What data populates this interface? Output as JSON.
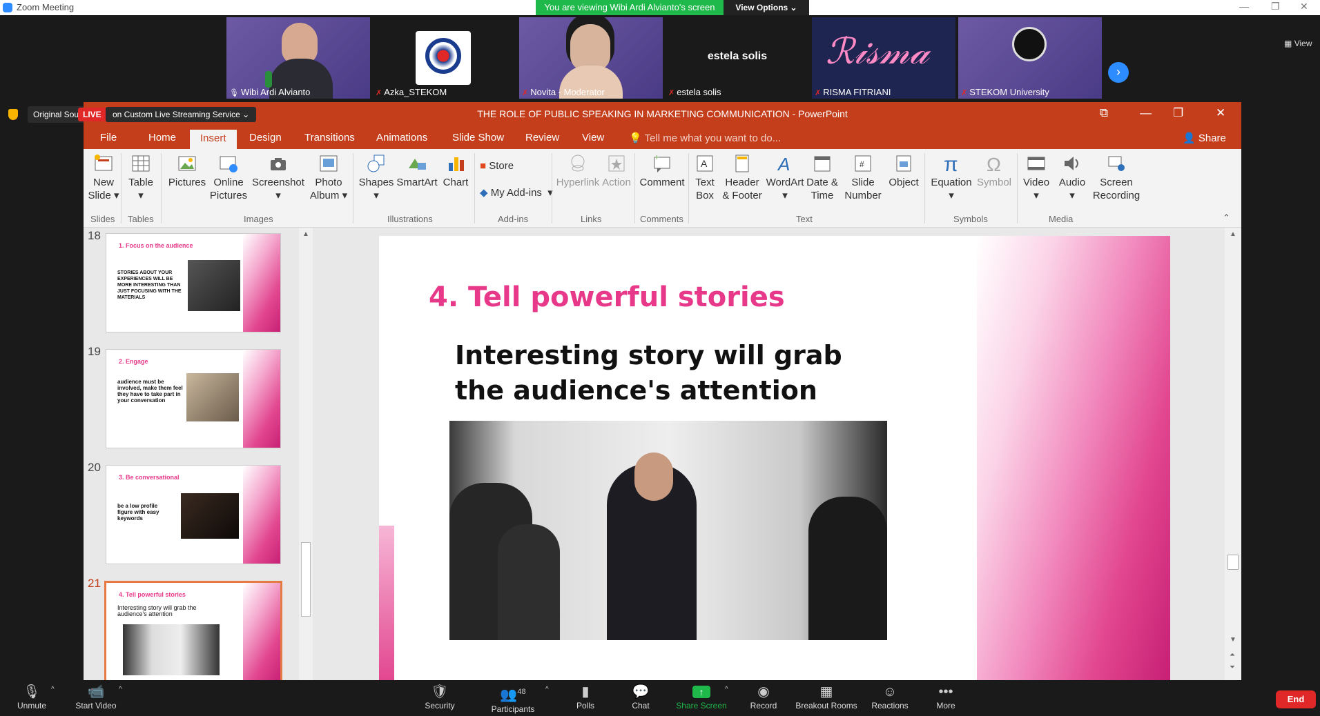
{
  "zoom": {
    "window_title": "Zoom Meeting",
    "viewing_banner": "You are viewing Wibi Ardi Alvianto's screen",
    "view_options": "View Options",
    "view_label": "View",
    "participants": [
      {
        "name": "Wibi Ardi Alvianto",
        "muted": false
      },
      {
        "name": "Azka_STEKOM",
        "muted": true
      },
      {
        "name": "Novita - Moderator",
        "muted": true
      },
      {
        "name": "estela solis",
        "muted": true
      },
      {
        "name": "RISMA FITRIANI",
        "muted": true
      },
      {
        "name": "STEKOM University",
        "muted": true
      }
    ],
    "estela_center_name": "estela solis",
    "original_sound": "Original Sound: On",
    "live_badge": "LIVE",
    "live_text": "on Custom Live Streaming Service",
    "toolbar": {
      "unmute": "Unmute",
      "start_video": "Start Video",
      "security": "Security",
      "participants": "Participants",
      "participants_count": "48",
      "polls": "Polls",
      "chat": "Chat",
      "share_screen": "Share Screen",
      "record": "Record",
      "breakout_rooms": "Breakout Rooms",
      "reactions": "Reactions",
      "more": "More",
      "end": "End"
    }
  },
  "ppt": {
    "title": "THE ROLE OF PUBLIC SPEAKING IN MARKETING COMMUNICATION - PowerPoint",
    "tabs": [
      "File",
      "Home",
      "Insert",
      "Design",
      "Transitions",
      "Animations",
      "Slide Show",
      "Review",
      "View"
    ],
    "active_tab": "Insert",
    "tell_me": "Tell me what you want to do...",
    "share": "Share",
    "ribbon": {
      "new_slide": [
        "New",
        "Slide"
      ],
      "table": "Table",
      "pictures": "Pictures",
      "online_pictures": [
        "Online",
        "Pictures"
      ],
      "screenshot": "Screenshot",
      "photo_album": [
        "Photo",
        "Album"
      ],
      "shapes": "Shapes",
      "smartart": "SmartArt",
      "chart": "Chart",
      "store": "Store",
      "my_addins": "My Add-ins",
      "hyperlink": "Hyperlink",
      "action": "Action",
      "comment": "Comment",
      "text_box": [
        "Text",
        "Box"
      ],
      "header_footer": [
        "Header",
        "& Footer"
      ],
      "wordart": "WordArt",
      "date_time": [
        "Date &",
        "Time"
      ],
      "slide_number": [
        "Slide",
        "Number"
      ],
      "object": "Object",
      "equation": "Equation",
      "symbol": "Symbol",
      "video": "Video",
      "audio": "Audio",
      "screen_recording": [
        "Screen",
        "Recording"
      ],
      "groups": {
        "slides": "Slides",
        "tables": "Tables",
        "images": "Images",
        "illustrations": "Illustrations",
        "addins": "Add-ins",
        "links": "Links",
        "comments": "Comments",
        "text": "Text",
        "symbols": "Symbols",
        "media": "Media"
      }
    },
    "thumbnails": [
      {
        "num": "18",
        "title": "1. Focus on the audience",
        "body": "STORIES ABOUT YOUR EXPERIENCES WILL BE MORE INTERESTING THAN JUST FOCUSING WITH THE MATERIALS"
      },
      {
        "num": "19",
        "title": "2. Engage",
        "body": "audience must be involved, make them feel they have to take part in your conversation"
      },
      {
        "num": "20",
        "title": "3. Be conversational",
        "body": "be a low profile figure with easy keywords"
      },
      {
        "num": "21",
        "title": "4. Tell powerful stories",
        "body": "Interesting story will grab the audience's attention"
      }
    ],
    "slide": {
      "title": "4. Tell powerful stories",
      "body": "Interesting story will grab the audience's attention"
    }
  },
  "colors": {
    "ppt_accent": "#c43e1c",
    "slide_pink": "#e8388a",
    "zoom_green": "#1fb84b",
    "zoom_blue": "#2d8cff",
    "end_red": "#e02828"
  }
}
